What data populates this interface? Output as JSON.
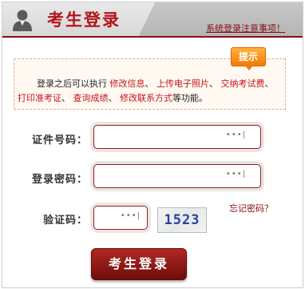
{
  "header": {
    "title": "考生登录",
    "notice_link": "系统登录注意事项！"
  },
  "tip": {
    "badge": "提示",
    "text_parts": [
      {
        "text": "登录之后可以执行 ",
        "highlight": false
      },
      {
        "text": "修改信息",
        "highlight": true
      },
      {
        "text": "、 ",
        "highlight": false
      },
      {
        "text": "上传电子照片",
        "highlight": true
      },
      {
        "text": "、 ",
        "highlight": false
      },
      {
        "text": "交纳考试费",
        "highlight": true
      },
      {
        "text": "、 ",
        "highlight": false
      },
      {
        "text": "打印准考证",
        "highlight": true
      },
      {
        "text": "、 ",
        "highlight": false
      },
      {
        "text": "查询成绩",
        "highlight": true
      },
      {
        "text": "、 ",
        "highlight": false
      },
      {
        "text": "修改联系方式",
        "highlight": true
      },
      {
        "text": "等功能。",
        "highlight": false
      }
    ]
  },
  "form": {
    "id_label": "证件号码：",
    "password_label": "登录密码：",
    "captcha_label": "验证码：",
    "id_value": "",
    "password_value": "",
    "captcha_value": "",
    "forgot_password": "忘记密码？",
    "captcha_image_text": "1523",
    "submit_label": "考生登录",
    "key_hint": "•••|"
  },
  "colors": {
    "brand_red": "#b3141d",
    "dark_red": "#8b0e14",
    "highlight": "#c8141c",
    "tip_orange": "#f07a0a"
  },
  "icons": {
    "avatar": "user-silhouette-icon"
  }
}
